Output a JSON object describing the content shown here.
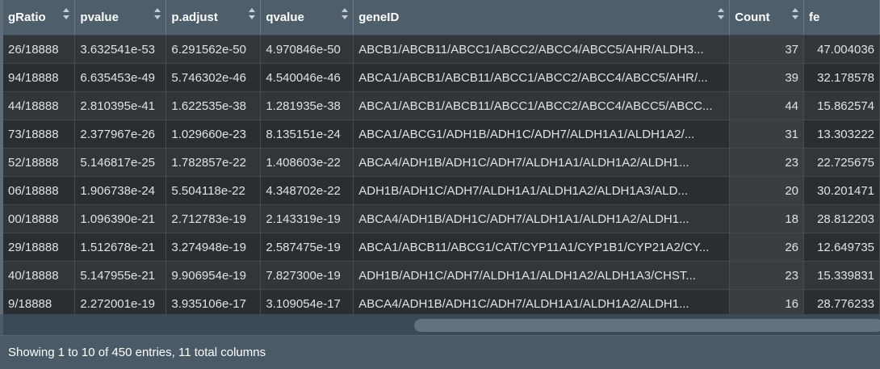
{
  "table": {
    "columns": [
      {
        "label": "gRatio",
        "sortable": true
      },
      {
        "label": "pvalue",
        "sortable": true
      },
      {
        "label": "p.adjust",
        "sortable": true
      },
      {
        "label": "qvalue",
        "sortable": true
      },
      {
        "label": "geneID",
        "sortable": true
      },
      {
        "label": "Count",
        "sortable": true
      },
      {
        "label": "fe",
        "sortable": false
      }
    ],
    "rows": [
      [
        "26/18888",
        "3.632541e-53",
        "6.291562e-50",
        "4.970846e-50",
        "ABCB1/ABCB11/ABCC1/ABCC2/ABCC4/ABCC5/AHR/ALDH3...",
        "37",
        "47.004036"
      ],
      [
        "94/18888",
        "6.635453e-49",
        "5.746302e-46",
        "4.540046e-46",
        "ABCA1/ABCB1/ABCB11/ABCC1/ABCC2/ABCC4/ABCC5/AHR/...",
        "39",
        "32.178578"
      ],
      [
        "44/18888",
        "2.810395e-41",
        "1.622535e-38",
        "1.281935e-38",
        "ABCA1/ABCB1/ABCB11/ABCC1/ABCC2/ABCC4/ABCC5/ABCC...",
        "44",
        "15.862574"
      ],
      [
        "73/18888",
        "2.377967e-26",
        "1.029660e-23",
        "8.135151e-24",
        "ABCA1/ABCG1/ADH1B/ADH1C/ADH7/ALDH1A1/ALDH1A2/...",
        "31",
        "13.303222"
      ],
      [
        "52/18888",
        "5.146817e-25",
        "1.782857e-22",
        "1.408603e-22",
        "ABCA4/ADH1B/ADH1C/ADH7/ALDH1A1/ALDH1A2/ALDH1...",
        "23",
        "22.725675"
      ],
      [
        "06/18888",
        "1.906738e-24",
        "5.504118e-22",
        "4.348702e-22",
        "ADH1B/ADH1C/ADH7/ALDH1A1/ALDH1A2/ALDH1A3/ALD...",
        "20",
        "30.201471"
      ],
      [
        "00/18888",
        "1.096390e-21",
        "2.712783e-19",
        "2.143319e-19",
        "ABCA4/ADH1B/ADH1C/ADH7/ALDH1A1/ALDH1A2/ALDH1...",
        "18",
        "28.812203"
      ],
      [
        "29/18888",
        "1.512678e-21",
        "3.274948e-19",
        "2.587475e-19",
        "ABCA1/ABCB11/ABCG1/CAT/CYP11A1/CYP1B1/CYP21A2/CY...",
        "26",
        "12.649735"
      ],
      [
        "40/18888",
        "5.147955e-21",
        "9.906954e-19",
        "7.827300e-19",
        "ADH1B/ADH1C/ADH7/ALDH1A1/ALDH1A2/ALDH1A3/CHST...",
        "23",
        "15.339831"
      ],
      [
        "9/18888",
        "2.272001e-19",
        "3.935106e-17",
        "3.109054e-17",
        "ABCA4/ADH1B/ADH1C/ADH7/ALDH1A1/ALDH1A2/ALDH1...",
        "16",
        "28.776233"
      ]
    ]
  },
  "footer": {
    "info": "Showing 1 to 10 of 450 entries, 11 total columns"
  }
}
